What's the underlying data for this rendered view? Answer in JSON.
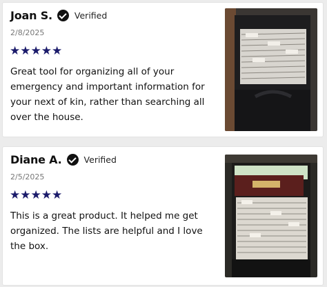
{
  "reviews": [
    {
      "name": "Joan S.",
      "verified": "Verified",
      "date": "2/8/2025",
      "rating": 5,
      "stars": "★★★★★",
      "text": "Great tool for organizing all of your emergency and important information for your next of kin, rather than searching all over the house.",
      "photo_icon": "file-box-photo"
    },
    {
      "name": "Diane A.",
      "verified": "Verified",
      "date": "2/5/2025",
      "rating": 5,
      "stars": "★★★★★",
      "text": "This is a great product. It helped me get organized. The lists are helpful and I love the box.",
      "photo_icon": "file-box-photo"
    }
  ],
  "colors": {
    "star": "#1b1b6b",
    "text": "#111111",
    "date": "#777777"
  }
}
